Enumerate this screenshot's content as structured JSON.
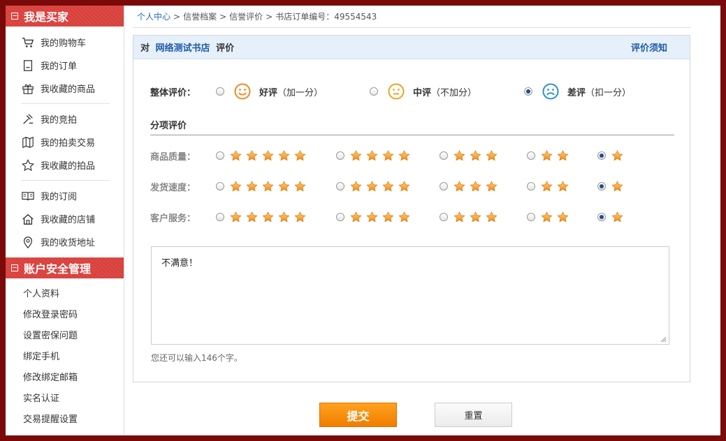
{
  "sidebar": {
    "buyer_title": "我是买家",
    "buyer_items": [
      {
        "label": "我的购物车",
        "icon": "cart-icon"
      },
      {
        "label": "我的订单",
        "icon": "order-icon"
      },
      {
        "label": "我收藏的商品",
        "icon": "gift-icon"
      },
      {
        "label": "我的竞拍",
        "icon": "gavel-icon"
      },
      {
        "label": "我的拍卖交易",
        "icon": "map-book-icon"
      },
      {
        "label": "我收藏的拍品",
        "icon": "star-outline-icon"
      },
      {
        "label": "我的订阅",
        "icon": "open-book-icon"
      },
      {
        "label": "我收藏的店铺",
        "icon": "home-icon"
      },
      {
        "label": "我的收货地址",
        "icon": "location-pin-icon"
      }
    ],
    "account_title": "账户安全管理",
    "account_items": [
      "个人资料",
      "修改登录密码",
      "设置密保问题",
      "绑定手机",
      "修改绑定邮箱",
      "实名认证",
      "交易提醒设置"
    ]
  },
  "breadcrumb": {
    "home": "个人中心",
    "sep": ">",
    "credit": "信誉档案",
    "review": "信誉评价",
    "order": "书店订单编号：49554543"
  },
  "panel": {
    "prefix": "对",
    "shop": "网络测试书店",
    "suffix": "评价",
    "notice": "评价须知"
  },
  "overall": {
    "label": "整体评价：",
    "options": [
      {
        "title": "好评",
        "note": "（加一分）",
        "selected": false,
        "color": "#f08a1f"
      },
      {
        "title": "中评",
        "note": "（不加分）",
        "selected": false,
        "color": "#f0a21f"
      },
      {
        "title": "差评",
        "note": "（扣一分）",
        "selected": true,
        "color": "#2a8fd6"
      }
    ]
  },
  "detail": {
    "title": "分项评价",
    "criteria": [
      {
        "label": "商品质量：",
        "rating": 1
      },
      {
        "label": "发货速度：",
        "rating": 1
      },
      {
        "label": "客户服务：",
        "rating": 1
      }
    ],
    "star_options": [
      5,
      4,
      3,
      2,
      1
    ]
  },
  "comment": {
    "value": "不满意！",
    "counter": "您还可以输入146个字。"
  },
  "buttons": {
    "submit": "提交",
    "reset": "重置"
  }
}
